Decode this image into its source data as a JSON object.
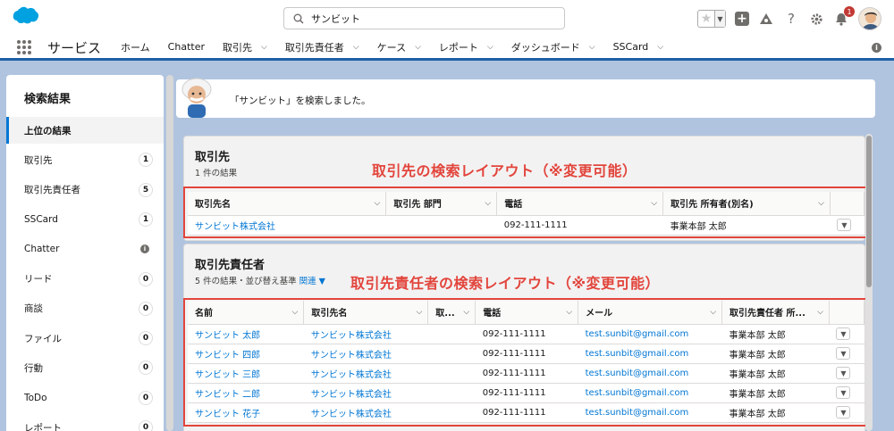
{
  "header": {
    "search_value": "サンビット",
    "notification_count": "1",
    "help_glyph": "?",
    "icons": [
      "favorites-star-icon",
      "add-icon",
      "trailhead-icon",
      "help-icon",
      "gear-icon",
      "bell-icon",
      "avatar"
    ]
  },
  "nav": {
    "app_name": "サービス",
    "items": [
      {
        "label": "ホーム",
        "dropdown": false
      },
      {
        "label": "Chatter",
        "dropdown": false
      },
      {
        "label": "取引先",
        "dropdown": true
      },
      {
        "label": "取引先責任者",
        "dropdown": true
      },
      {
        "label": "ケース",
        "dropdown": true
      },
      {
        "label": "レポート",
        "dropdown": true
      },
      {
        "label": "ダッシュボード",
        "dropdown": true
      },
      {
        "label": "SSCard",
        "dropdown": true
      }
    ]
  },
  "sidebar": {
    "title": "検索結果",
    "items": [
      {
        "label": "上位の結果",
        "count": ""
      },
      {
        "label": "取引先",
        "count": "1"
      },
      {
        "label": "取引先責任者",
        "count": "5"
      },
      {
        "label": "SSCard",
        "count": "1"
      },
      {
        "label": "Chatter",
        "count": "i"
      },
      {
        "label": "リード",
        "count": "0"
      },
      {
        "label": "商談",
        "count": "0"
      },
      {
        "label": "ファイル",
        "count": "0"
      },
      {
        "label": "行動",
        "count": "0"
      },
      {
        "label": "ToDo",
        "count": "0"
      },
      {
        "label": "レポート",
        "count": "0"
      }
    ]
  },
  "banner": {
    "text": "「サンビット」を検索しました。"
  },
  "accounts_card": {
    "title": "取引先",
    "subtitle": "1 件の結果",
    "annotation": "取引先の検索レイアウト（※変更可能）",
    "columns": [
      "取引先名",
      "取引先 部門",
      "電話",
      "取引先 所有者(別名)"
    ],
    "rows": [
      {
        "name": "サンビット株式会社",
        "dept": "",
        "phone": "092-111-1111",
        "owner": "事業本部 太郎"
      }
    ]
  },
  "contacts_card": {
    "title": "取引先責任者",
    "subtitle": "5 件の結果・並び替え基準",
    "sort_link": "関連",
    "annotation": "取引先責任者の検索レイアウト（※変更可能）",
    "columns": [
      "名前",
      "取引先名",
      "取...",
      "電話",
      "メール",
      "取引先責任者 所..."
    ],
    "rows": [
      {
        "name": "サンビット 太郎",
        "account": "サンビット株式会社",
        "x": "",
        "phone": "092-111-1111",
        "email": "test.sunbit@gmail.com",
        "owner": "事業本部 太郎"
      },
      {
        "name": "サンビット 四郎",
        "account": "サンビット株式会社",
        "x": "",
        "phone": "092-111-1111",
        "email": "test.sunbit@gmail.com",
        "owner": "事業本部 太郎"
      },
      {
        "name": "サンビット 三郎",
        "account": "サンビット株式会社",
        "x": "",
        "phone": "092-111-1111",
        "email": "test.sunbit@gmail.com",
        "owner": "事業本部 太郎"
      },
      {
        "name": "サンビット 二郎",
        "account": "サンビット株式会社",
        "x": "",
        "phone": "092-111-1111",
        "email": "test.sunbit@gmail.com",
        "owner": "事業本部 太郎"
      },
      {
        "name": "サンビット 花子",
        "account": "サンビット株式会社",
        "x": "",
        "phone": "092-111-1111",
        "email": "test.sunbit@gmail.com",
        "owner": "事業本部 太郎"
      }
    ]
  },
  "colors": {
    "brand_blue": "#0176d3",
    "annotation_red": "#e2453c",
    "header_band": "#1f5fa6"
  }
}
